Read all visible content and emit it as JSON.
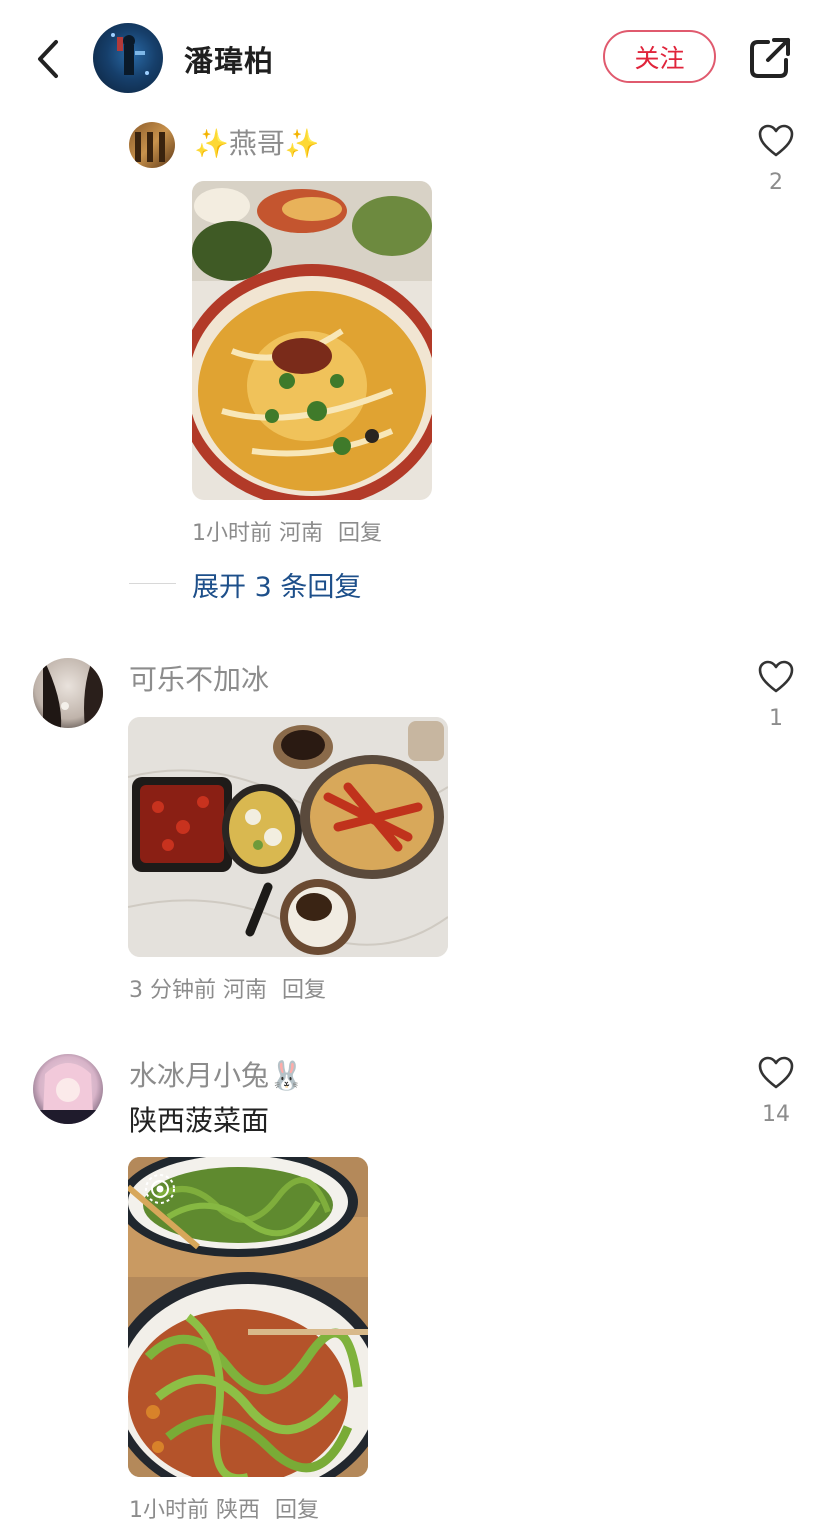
{
  "header": {
    "username": "潘瑋柏",
    "follow_label": "关注"
  },
  "comments": [
    {
      "name": "✨燕哥✨",
      "likes": "2",
      "time": "1小时前",
      "location": "河南",
      "reply_label": "回复",
      "expand_label": "展开 3 条回复"
    },
    {
      "name": "可乐不加冰",
      "likes": "1",
      "time": "3 分钟前",
      "location": "河南",
      "reply_label": "回复"
    },
    {
      "name": "水冰月小兔🐰",
      "text": "陕西菠菜面",
      "likes": "14",
      "time": "1小时前",
      "location": "陕西",
      "reply_label": "回复"
    }
  ],
  "icons": {
    "back": "chevron-left-icon",
    "share": "share-icon",
    "like": "heart-outline-icon",
    "live_photo": "live-photo-icon"
  },
  "colors": {
    "follow_red": "#e0243b",
    "expand_blue": "#1d4f8a",
    "meta_gray": "#8c8c8c"
  }
}
